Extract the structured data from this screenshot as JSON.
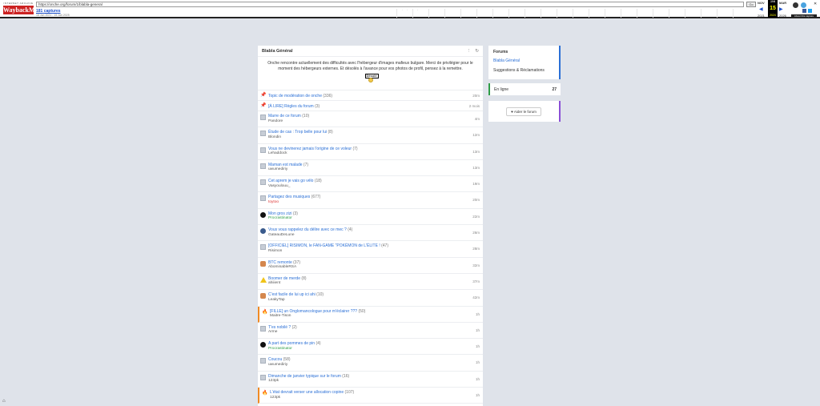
{
  "wayback": {
    "logo_small": "INTERNET ARCHIVE",
    "logo_big": "WaybackMachine",
    "url": "https://onche.org/forum/1/blabla-general",
    "go_label": "Go",
    "captures": "181 captures",
    "range": "16 Jun 2021 - 15 Jan 2025",
    "prev_month": "NOV",
    "cur_month": "JAN",
    "next_month": "MAR",
    "day": "15",
    "prev_year": "2021",
    "cur_year": "2024",
    "next_year": "2026",
    "about": "About this capture"
  },
  "forum": {
    "title": "Blabla Général",
    "notice": "Onche rencontre actuellement des difficultés avec l'hébergeur d'images mafieux bulgare. Merci de privilégier pour le moment des hébergeurs externes. Et désolés à l'avance pour vos photos de profil, pensez à la remettre.",
    "sticker_text": "Désolé",
    "topics": [
      {
        "title": "Topic de modération de onche",
        "count": "(336)",
        "author": "",
        "time": "20m",
        "avatar": "pin",
        "author_style": ""
      },
      {
        "title": "[À LIRE] Règles du forum",
        "count": "(3)",
        "author": "",
        "time": "2 mois",
        "avatar": "pinred",
        "author_style": ""
      },
      {
        "title": "Marre de ce forum",
        "count": "(10)",
        "author": "Pandore",
        "time": "4m",
        "avatar": "img",
        "author_style": ""
      },
      {
        "title": "Étude de cas : Trop belle pour lui",
        "count": "(8)",
        "author": "Blondin",
        "time": "12m",
        "avatar": "img",
        "author_style": ""
      },
      {
        "title": "Vous ne devinerez jamais l'origine de ce voleur",
        "count": "(7)",
        "author": "Lehaddock",
        "time": "13m",
        "avatar": "img",
        "author_style": ""
      },
      {
        "title": "Maman est malade",
        "count": "(7)",
        "author": "uwumediriy",
        "time": "13m",
        "avatar": "img",
        "author_style": ""
      },
      {
        "title": "Cet aprem je vais go vélo",
        "count": "(18)",
        "author": "Vasyoulouu_",
        "time": "19m",
        "avatar": "img",
        "author_style": ""
      },
      {
        "title": "Partagez des musiques",
        "count": "(677)",
        "author": "toytoo",
        "time": "20m",
        "avatar": "img",
        "author_style": "red"
      },
      {
        "title": "Mon gros zizi",
        "count": "(3)",
        "author": "Procrastinator",
        "time": "22m",
        "avatar": "dark",
        "author_style": "green"
      },
      {
        "title": "Vous vous rappelez du délire avec ce mec ?",
        "count": "(4)",
        "author": "GateauDeLune",
        "time": "26m",
        "avatar": "pkb",
        "author_style": ""
      },
      {
        "title": "[OFFICIEL] RISIMON, le FAN-GAME \"POKÉMON de L'ÉLITE !",
        "count": "(47)",
        "author": "Risimon",
        "time": "28m",
        "avatar": "img",
        "author_style": ""
      },
      {
        "title": "BTC remonte",
        "count": "(37)",
        "author": "AbominableRSA",
        "time": "32m",
        "avatar": "orange",
        "author_style": ""
      },
      {
        "title": "Boomer de merde",
        "count": "(8)",
        "author": "ahiiient",
        "time": "37m",
        "avatar": "warn",
        "author_style": ""
      },
      {
        "title": "C'est facile de lui up ici ahi",
        "count": "(10)",
        "author": "LeakyTap",
        "time": "42m",
        "avatar": "orange",
        "author_style": ""
      },
      {
        "title": "[FILLE] un Onglomancologue pour m'éclairer ???",
        "count": "(50)",
        "author": "Maitre-Tison",
        "time": "1h",
        "avatar": "fire",
        "author_style": "",
        "hot": true
      },
      {
        "title": "T'es nobilé ?",
        "count": "(2)",
        "author": "Arme",
        "time": "1h",
        "avatar": "img",
        "author_style": ""
      },
      {
        "title": "A part des pommes de pin",
        "count": "(4)",
        "author": "Procrastinator",
        "time": "1h",
        "avatar": "dark",
        "author_style": "green"
      },
      {
        "title": "Coucou",
        "count": "(58)",
        "author": "uwumediriy",
        "time": "1h",
        "avatar": "img",
        "author_style": ""
      },
      {
        "title": "Dimanche de janvier typique sur le forum",
        "count": "(16)",
        "author": "123pk",
        "time": "1h",
        "avatar": "img",
        "author_style": ""
      },
      {
        "title": "L'état devrait verser une allocation copine",
        "count": "(107)",
        "author": "123pk",
        "time": "1h",
        "avatar": "fire",
        "author_style": "",
        "hot": true
      }
    ]
  },
  "sidebar": {
    "forums_title": "Forums",
    "forum_links": [
      "Blabla Général",
      "Suggestions & Réclamations"
    ],
    "online_label": "En ligne",
    "online_count": "27",
    "help_button": "Aider le forum"
  },
  "icons": {
    "menu": "more-vertical-icon",
    "refresh": "refresh-icon",
    "heart": "heart-icon",
    "pin": "pin-icon",
    "fire": "fire-icon"
  }
}
